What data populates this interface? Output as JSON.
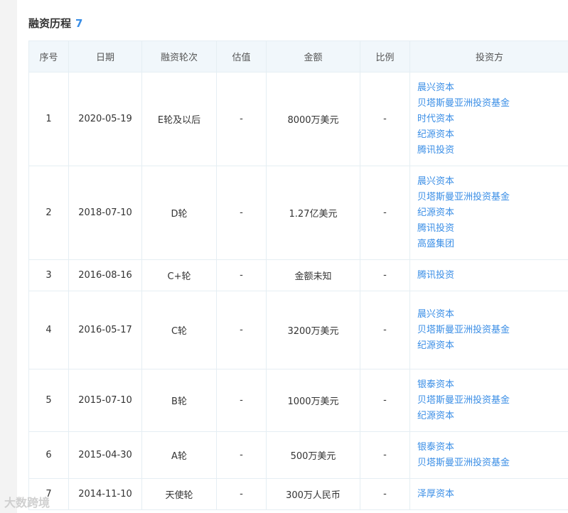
{
  "section": {
    "title": "融资历程",
    "count": "7"
  },
  "table": {
    "headers": [
      "序号",
      "日期",
      "融资轮次",
      "估值",
      "金额",
      "比例",
      "投资方"
    ],
    "rows": [
      {
        "index": "1",
        "date": "2020-05-19",
        "round": "E轮及以后",
        "valuation": "-",
        "amount": "8000万美元",
        "ratio": "-",
        "investors": [
          "晨兴资本",
          "贝塔斯曼亚洲投资基金",
          "时代资本",
          "纪源资本",
          "腾讯投资"
        ]
      },
      {
        "index": "2",
        "date": "2018-07-10",
        "round": "D轮",
        "valuation": "-",
        "amount": "1.27亿美元",
        "ratio": "-",
        "investors": [
          "晨兴资本",
          "贝塔斯曼亚洲投资基金",
          "纪源资本",
          "腾讯投资",
          "高盛集团"
        ]
      },
      {
        "index": "3",
        "date": "2016-08-16",
        "round": "C+轮",
        "valuation": "-",
        "amount": "金额未知",
        "ratio": "-",
        "investors": [
          "腾讯投资"
        ]
      },
      {
        "index": "4",
        "date": "2016-05-17",
        "round": "C轮",
        "valuation": "-",
        "amount": "3200万美元",
        "ratio": "-",
        "investors": [
          "晨兴资本",
          "贝塔斯曼亚洲投资基金",
          "纪源资本"
        ]
      },
      {
        "index": "5",
        "date": "2015-07-10",
        "round": "B轮",
        "valuation": "-",
        "amount": "1000万美元",
        "ratio": "-",
        "investors": [
          "银泰资本",
          "贝塔斯曼亚洲投资基金",
          "纪源资本"
        ]
      },
      {
        "index": "6",
        "date": "2015-04-30",
        "round": "A轮",
        "valuation": "-",
        "amount": "500万美元",
        "ratio": "-",
        "investors": [
          "银泰资本",
          "贝塔斯曼亚洲投资基金"
        ]
      },
      {
        "index": "7",
        "date": "2014-11-10",
        "round": "天使轮",
        "valuation": "-",
        "amount": "300万人民币",
        "ratio": "-",
        "investors": [
          "泽厚资本"
        ]
      }
    ]
  },
  "watermark": {
    "text": "大数跨境"
  },
  "colors": {
    "link": "#3a8ee6",
    "header_bg": "#f1f7fb",
    "border": "#e5eef3"
  }
}
